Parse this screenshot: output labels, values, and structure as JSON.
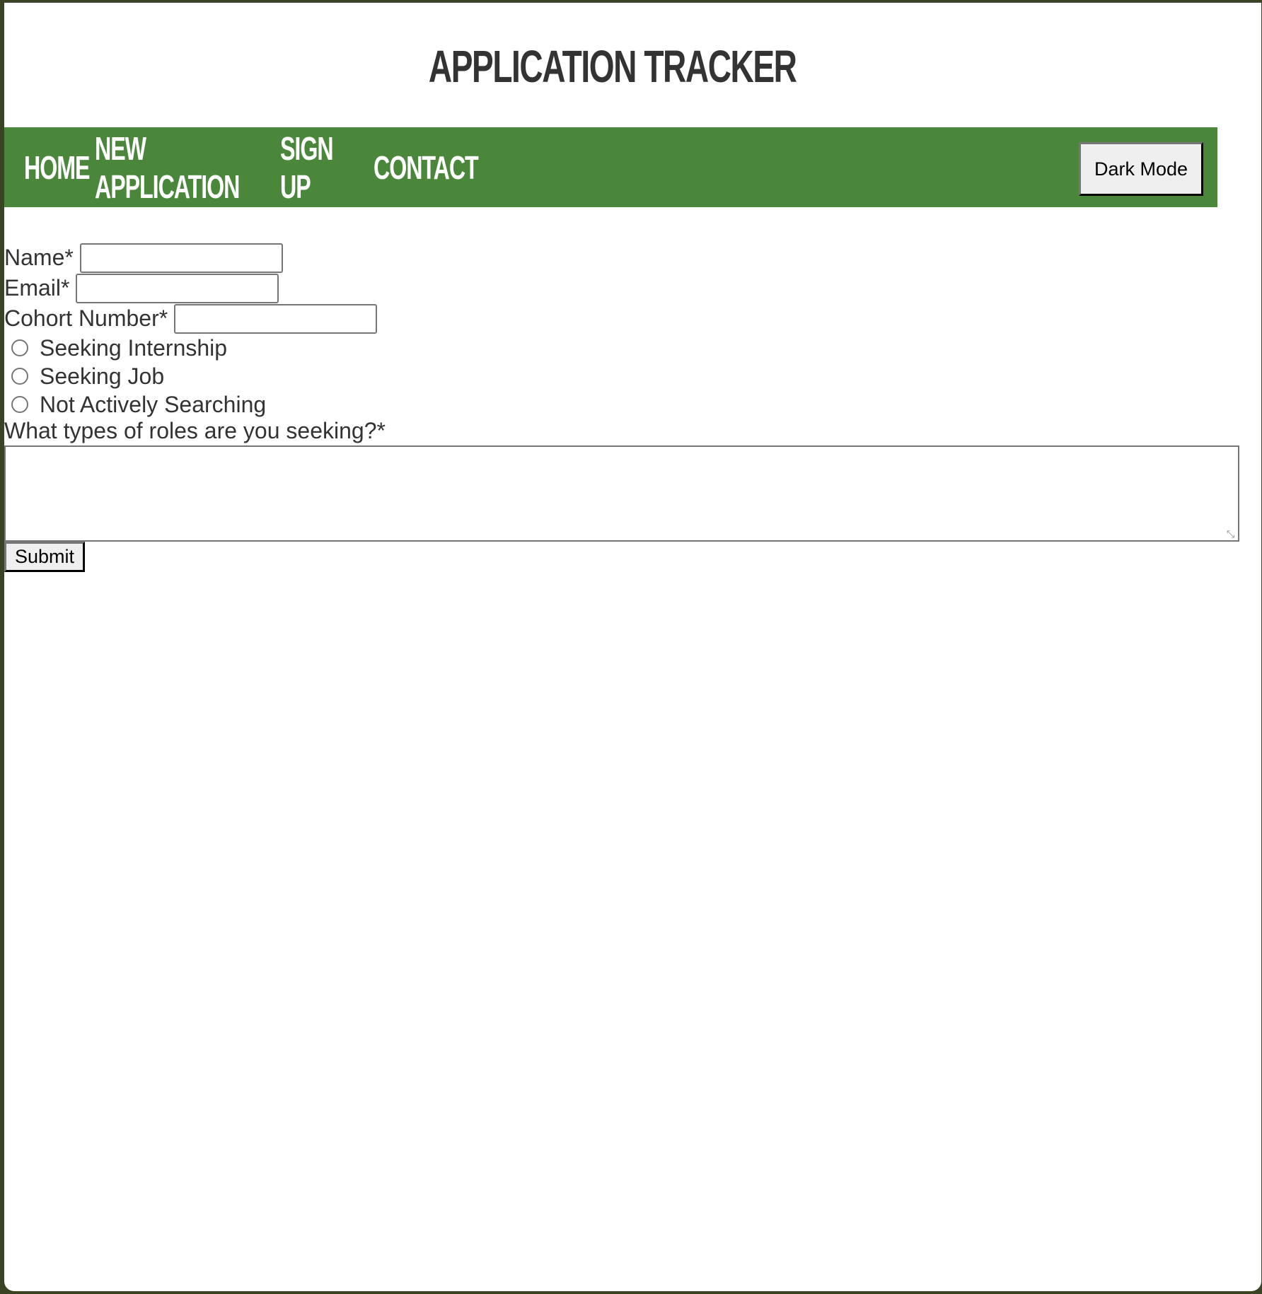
{
  "header": {
    "title": "APPLICATION TRACKER"
  },
  "nav": {
    "links": [
      {
        "label": "HOME"
      },
      {
        "label": "NEW APPLICATION"
      },
      {
        "label": "SIGN UP"
      },
      {
        "label": "CONTACT"
      }
    ],
    "dark_mode_label": "Dark Mode",
    "background_color": "#4a873b"
  },
  "form": {
    "name_label": "Name*",
    "name_value": "",
    "email_label": "Email*",
    "email_value": "",
    "cohort_label": "Cohort Number*",
    "cohort_value": "",
    "status_options": [
      {
        "label": "Seeking Internship",
        "checked": false
      },
      {
        "label": "Seeking Job",
        "checked": false
      },
      {
        "label": "Not Actively Searching",
        "checked": false
      }
    ],
    "roles_label": "What types of roles are you seeking?*",
    "roles_value": "",
    "submit_label": "Submit"
  }
}
